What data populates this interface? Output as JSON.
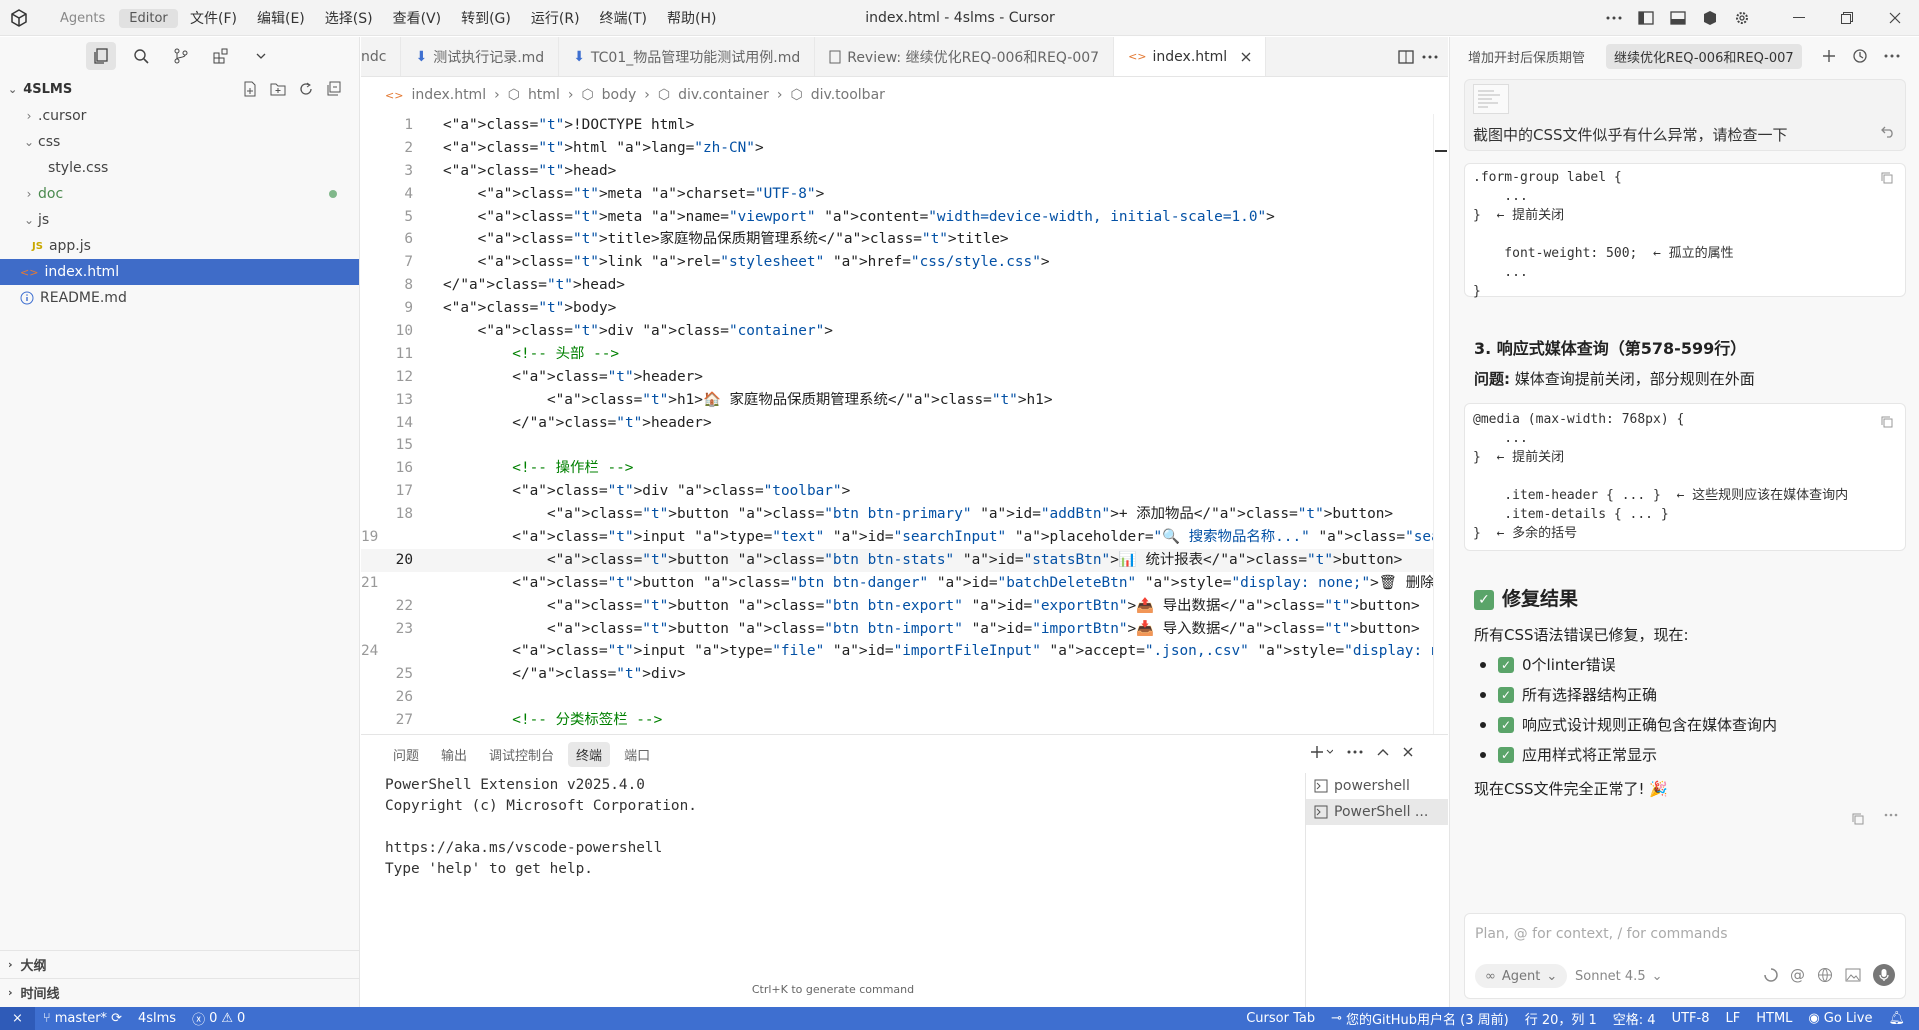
{
  "titlebar": {
    "modes": [
      "Agents",
      "Editor"
    ],
    "menu": [
      "文件(F)",
      "编辑(E)",
      "选择(S)",
      "查看(V)",
      "转到(G)",
      "运行(R)",
      "终端(T)",
      "帮助(H)"
    ],
    "title": "index.html - 4slms - Cursor"
  },
  "explorer": {
    "root": "4SLMS",
    "items": [
      {
        "label": ".cursor"
      },
      {
        "label": "css"
      },
      {
        "label": "style.css"
      },
      {
        "label": "doc"
      },
      {
        "label": "js"
      },
      {
        "label": "app.js",
        "badge": "JS"
      },
      {
        "label": "index.html"
      },
      {
        "label": "README.md"
      }
    ],
    "outline": "大纲",
    "timeline": "时间线"
  },
  "tabs": [
    "ndc",
    "测试执行记录.md",
    "TC01_物品管理功能测试用例.md",
    "Review: 继续优化REQ-006和REQ-007",
    "index.html"
  ],
  "breadcrumb": [
    "index.html",
    "html",
    "body",
    "div.container",
    "div.toolbar"
  ],
  "code": {
    "lines": [
      "1",
      "2",
      "3",
      "4",
      "5",
      "6",
      "7",
      "8",
      "9",
      "10",
      "11",
      "12",
      "13",
      "14",
      "15",
      "16",
      "17",
      "18",
      "19",
      "20",
      "21",
      "22",
      "23",
      "24",
      "25",
      "26",
      "27"
    ],
    "content": [
      "<!DOCTYPE html>",
      "<html lang=\"zh-CN\">",
      "<head>",
      "    <meta charset=\"UTF-8\">",
      "    <meta name=\"viewport\" content=\"width=device-width, initial-scale=1.0\">",
      "    <title>家庭物品保质期管理系统</title>",
      "    <link rel=\"stylesheet\" href=\"css/style.css\">",
      "</head>",
      "<body>",
      "    <div class=\"container\">",
      "        <!-- 头部 -->",
      "        <header>",
      "            <h1>🏠 家庭物品保质期管理系统</h1>",
      "        </header>",
      "",
      "        <!-- 操作栏 -->",
      "        <div class=\"toolbar\">",
      "            <button class=\"btn btn-primary\" id=\"addBtn\">+ 添加物品</button>",
      "            <input type=\"text\" id=\"searchInput\" placeholder=\"🔍 搜索物品名称...\" class=\"search-input\">",
      "            <button class=\"btn btn-stats\" id=\"statsBtn\">📊 统计报表</button>",
      "            <button class=\"btn btn-danger\" id=\"batchDeleteBtn\" style=\"display: none;\">🗑 删除选中 (<span id=\"",
      "            <button class=\"btn btn-export\" id=\"exportBtn\">📤 导出数据</button>",
      "            <button class=\"btn btn-import\" id=\"importBtn\">📥 导入数据</button>",
      "            <input type=\"file\" id=\"importFileInput\" accept=\".json,.csv\" style=\"display: none;\">",
      "        </div>",
      "",
      "        <!-- 分类标签栏 -->"
    ]
  },
  "panel": {
    "tabs": [
      "问题",
      "输出",
      "调试控制台",
      "终端",
      "端口"
    ],
    "terminal": "PowerShell Extension v2025.4.0\nCopyright (c) Microsoft Corporation.\n\nhttps://aka.ms/vscode-powershell\nType 'help' to get help.",
    "terminals": [
      "powershell",
      "PowerShell ..."
    ],
    "hint": "Ctrl+K to generate command"
  },
  "chat": {
    "tabs": [
      "增加开封后保质期管",
      "继续优化REQ-006和REQ-007"
    ],
    "user_message": "截图中的CSS文件似乎有什么异常，请检查一下",
    "code1": ".form-group label {\n    ...\n}  ← 提前关闭\n\n    font-weight: 500;  ← 孤立的属性\n    ...\n}",
    "section3_title": "3. 响应式媒体查询（第578-599行）",
    "issue_label": "问题:",
    "issue_text": "媒体查询提前关闭，部分规则在外面",
    "code2": "@media (max-width: 768px) {\n    ...\n}  ← 提前关闭\n\n    .item-header { ... }  ← 这些规则应该在媒体查询内\n    .item-details { ... }\n}  ← 多余的括号",
    "result_title": "修复结果",
    "result_intro": "所有CSS语法错误已修复，现在:",
    "checks": [
      "0个linter错误",
      "所有选择器结构正确",
      "响应式设计规则正确包含在媒体查询内",
      "应用样式将正常显示"
    ],
    "closing": "现在CSS文件完全正常了! 🎉",
    "input_placeholder": "Plan, @ for context, / for commands",
    "agent_label": "Agent",
    "model_label": "Sonnet 4.5"
  },
  "status": {
    "branch": "master*",
    "project": "4slms",
    "errors": "0",
    "warnings": "0",
    "cursor_tab": "Cursor Tab",
    "blame": "您的GitHub用户名 (3 周前)",
    "position": "行 20，列 1",
    "spaces": "空格: 4",
    "encoding": "UTF-8",
    "eol": "LF",
    "language": "HTML",
    "golive": "Go Live"
  },
  "colors": {
    "accent": "#3e6fd0",
    "selection": "#3f6cc8",
    "check": "#5aa469"
  }
}
